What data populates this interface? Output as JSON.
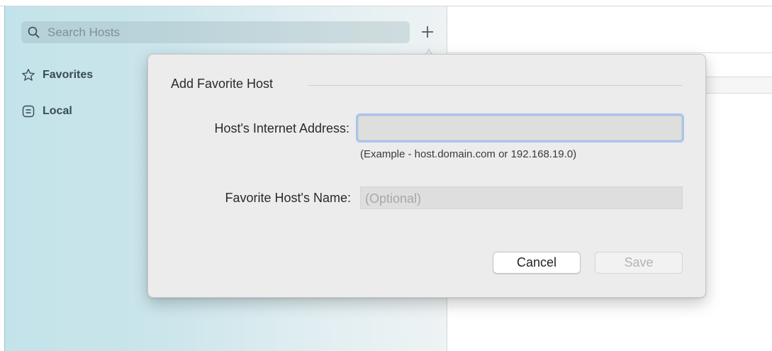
{
  "sidebar": {
    "search": {
      "placeholder": "Search Hosts"
    },
    "items": [
      {
        "label": "Favorites",
        "icon": "star-icon"
      },
      {
        "label": "Local",
        "icon": "local-list-icon"
      }
    ],
    "add_icon": "plus-icon"
  },
  "dialog": {
    "title": "Add Favorite Host",
    "address": {
      "label": "Host's Internet Address:",
      "value": "",
      "hint": "(Example - host.domain.com or 192.168.19.0)"
    },
    "name": {
      "label": "Favorite Host's Name:",
      "placeholder": "(Optional)",
      "value": ""
    },
    "buttons": {
      "cancel": "Cancel",
      "save": "Save"
    }
  },
  "colors": {
    "sidebar_tint": "#c3e3ea",
    "focus_ring": "#a9c4ef",
    "popover_bg": "#ececec"
  }
}
